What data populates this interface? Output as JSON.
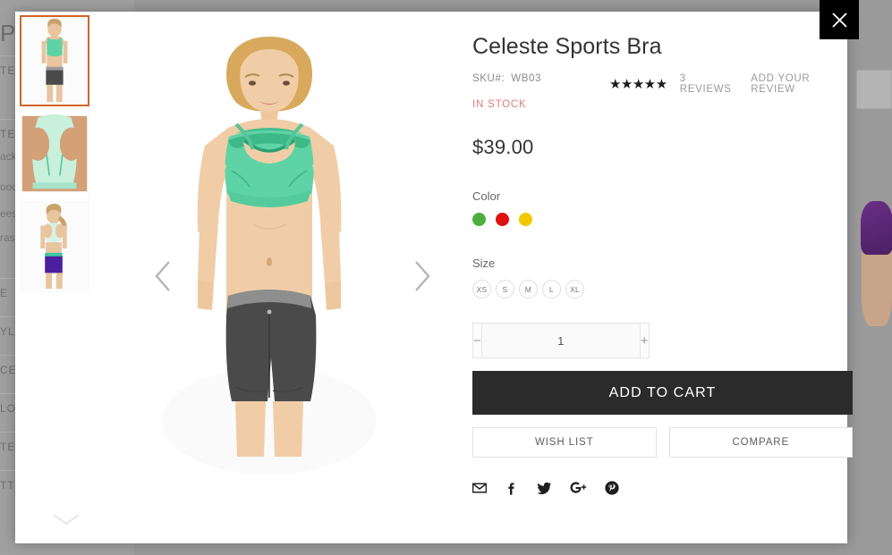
{
  "backdrop": {
    "page_heading": "PS",
    "category_items": [
      "acks",
      "ood",
      "ees",
      "ras"
    ],
    "filter_items": [
      "TEG",
      "TEG",
      "E",
      "YLE",
      "CE",
      "LOR",
      "TER",
      "TTE"
    ]
  },
  "modal": {
    "close_label": "Close",
    "close_icon": "close-icon"
  },
  "gallery": {
    "prev_label": "Previous",
    "next_label": "Next",
    "prev_icon": "chevron-left-icon",
    "next_icon": "chevron-right-icon",
    "scroll_icon": "chevron-down-icon",
    "thumbs": [
      {
        "alt": "Celeste Sports Bra front view",
        "active": true
      },
      {
        "alt": "Celeste Sports Bra back detail",
        "active": false
      },
      {
        "alt": "Celeste Sports Bra back view",
        "active": false
      }
    ]
  },
  "product": {
    "title": "Celeste Sports Bra",
    "sku_label": "SKU#:",
    "sku_value": "WB03",
    "stock_status": "IN STOCK",
    "price": "$39.00",
    "stars": "★★★★★",
    "rating_value": 5,
    "reviews_link": "3 REVIEWS",
    "add_review_link": "ADD YOUR REVIEW"
  },
  "options": {
    "color": {
      "label": "Color",
      "swatches": [
        {
          "name": "green",
          "hex": "#4BAF3B"
        },
        {
          "name": "red",
          "hex": "#E01111"
        },
        {
          "name": "yellow",
          "hex": "#F2C800"
        }
      ]
    },
    "size": {
      "label": "Size",
      "swatches": [
        "XS",
        "S",
        "M",
        "L",
        "XL"
      ]
    }
  },
  "cart": {
    "qty_value": "1",
    "qty_decrease": "−",
    "qty_increase": "+",
    "add_to_cart_label": "ADD TO CART",
    "wish_list_label": "WISH LIST",
    "compare_label": "COMPARE"
  },
  "social": [
    {
      "name": "email-icon",
      "title": "Email"
    },
    {
      "name": "facebook-icon",
      "title": "Facebook"
    },
    {
      "name": "twitter-icon",
      "title": "Twitter"
    },
    {
      "name": "google-plus-icon",
      "title": "Google Plus"
    },
    {
      "name": "pinterest-icon",
      "title": "Pinterest"
    }
  ],
  "colors": {
    "accent_active_thumb": "#d0652a",
    "cart_button": "#2b2b2b",
    "stock_text": "#e07b7b"
  }
}
